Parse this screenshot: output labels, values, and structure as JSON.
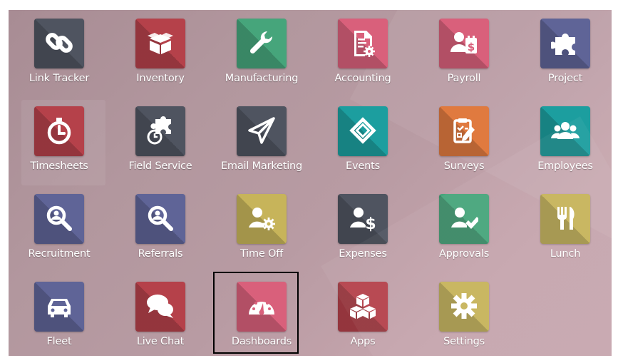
{
  "apps": [
    {
      "name": "Link Tracker",
      "color": "#4f5460",
      "icon": "link-icon"
    },
    {
      "name": "Inventory",
      "color": "#b5414a",
      "icon": "box-icon"
    },
    {
      "name": "Manufacturing",
      "color": "#46a57b",
      "icon": "wrench-icon"
    },
    {
      "name": "Accounting",
      "color": "#d9607b",
      "icon": "invoice-gear-icon"
    },
    {
      "name": "Payroll",
      "color": "#d9607b",
      "icon": "user-invoice-icon"
    },
    {
      "name": "Project",
      "color": "#5f6497",
      "icon": "puzzle-icon"
    },
    {
      "name": "Timesheets",
      "color": "#b5414a",
      "icon": "stopwatch-icon"
    },
    {
      "name": "Field Service",
      "color": "#4f5460",
      "icon": "puzzle-clock-icon"
    },
    {
      "name": "Email Marketing",
      "color": "#4f5460",
      "icon": "paper-plane-icon"
    },
    {
      "name": "Events",
      "color": "#1c9e9f",
      "icon": "ticket-icon"
    },
    {
      "name": "Surveys",
      "color": "#e07a3f",
      "icon": "clipboard-check-icon"
    },
    {
      "name": "Employees",
      "color": "#1c9e9f",
      "icon": "users-icon"
    },
    {
      "name": "Recruitment",
      "color": "#5f6497",
      "icon": "magnifier-icon"
    },
    {
      "name": "Referrals",
      "color": "#5f6497",
      "icon": "magnifier-icon"
    },
    {
      "name": "Time Off",
      "color": "#c7b45a",
      "icon": "user-gear-icon"
    },
    {
      "name": "Expenses",
      "color": "#4f5460",
      "icon": "user-dollar-icon"
    },
    {
      "name": "Approvals",
      "color": "#46a57b",
      "icon": "user-check-icon"
    },
    {
      "name": "Lunch",
      "color": "#c7b45a",
      "icon": "fork-knife-icon"
    },
    {
      "name": "Fleet",
      "color": "#5f6497",
      "icon": "car-icon"
    },
    {
      "name": "Live Chat",
      "color": "#b5414a",
      "icon": "chat-bubbles-icon"
    },
    {
      "name": "Dashboards",
      "color": "#d9607b",
      "icon": "gauge-icon"
    },
    {
      "name": "Apps",
      "color": "#b5414a",
      "icon": "cubes-icon"
    },
    {
      "name": "Settings",
      "color": "#c7b45a",
      "icon": "gear-icon"
    }
  ],
  "selected_app": "Dashboards"
}
